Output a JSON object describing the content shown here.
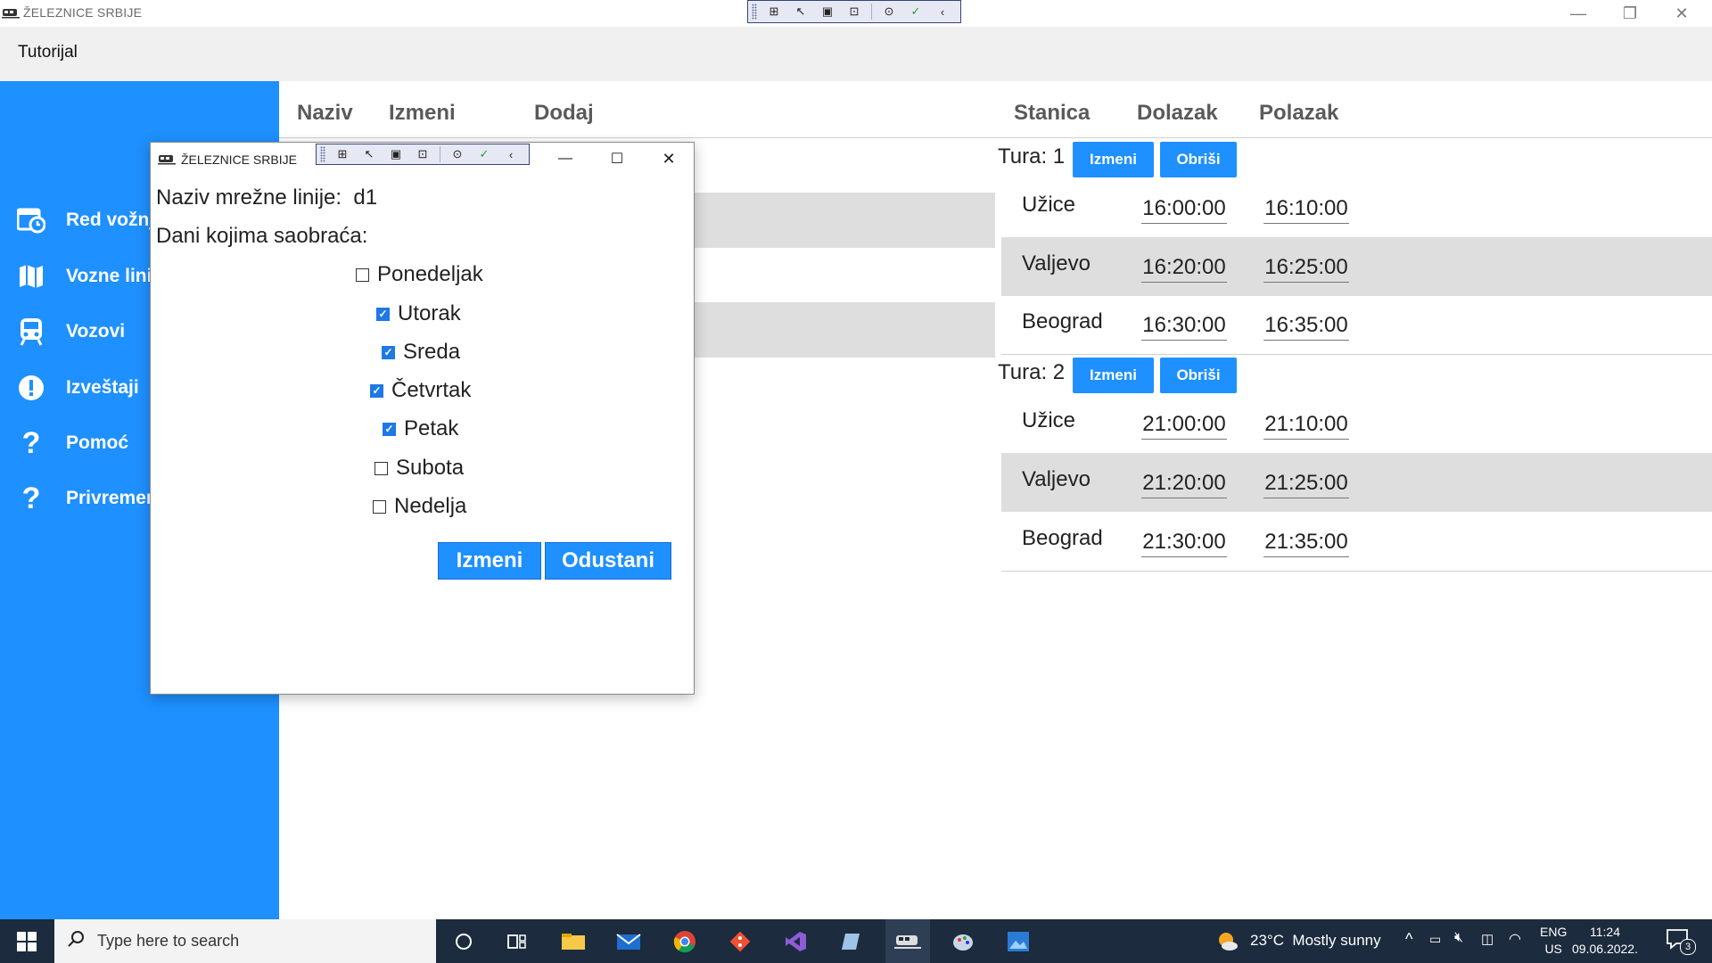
{
  "window": {
    "title": "ŽELEZNICE SRBIJE",
    "controls": [
      "—",
      "❐",
      "✕"
    ]
  },
  "menu": {
    "tutorial": "Tutorijal"
  },
  "sidebar": {
    "items": [
      {
        "label": "Red vožnje",
        "icon": "schedule-icon"
      },
      {
        "label": "Vozne linije",
        "icon": "map-icon"
      },
      {
        "label": "Vozovi",
        "icon": "train-icon"
      },
      {
        "label": "Izveštaji",
        "icon": "alert-icon"
      },
      {
        "label": "Pomoć",
        "icon": "help-icon"
      },
      {
        "label": "Privremeno",
        "icon": "help-icon"
      }
    ]
  },
  "lines_table": {
    "headers": [
      "Naziv",
      "Izmeni",
      "Dodaj"
    ]
  },
  "schedule": {
    "headers": [
      "Stanica",
      "Dolazak",
      "Polazak"
    ],
    "tura_label": "Tura:",
    "edit_label": "Izmeni",
    "delete_label": "Obriši",
    "tours": [
      {
        "number": "1",
        "stops": [
          {
            "station": "Užice",
            "arrival": "16:00:00",
            "departure": "16:10:00"
          },
          {
            "station": "Valjevo",
            "arrival": "16:20:00",
            "departure": "16:25:00"
          },
          {
            "station": "Beograd",
            "arrival": "16:30:00",
            "departure": "16:35:00"
          }
        ]
      },
      {
        "number": "2",
        "stops": [
          {
            "station": "Užice",
            "arrival": "21:00:00",
            "departure": "21:10:00"
          },
          {
            "station": "Valjevo",
            "arrival": "21:20:00",
            "departure": "21:25:00"
          },
          {
            "station": "Beograd",
            "arrival": "21:30:00",
            "departure": "21:35:00"
          }
        ]
      }
    ]
  },
  "dialog": {
    "title": "ŽELEZNICE SRBIJE",
    "line_name_label": "Naziv mrežne linije:",
    "line_name_value": "d1",
    "days_label": "Dani kojima saobraća:",
    "days": [
      {
        "label": "Ponedeljak",
        "checked": false
      },
      {
        "label": "Utorak",
        "checked": true
      },
      {
        "label": "Sreda",
        "checked": true
      },
      {
        "label": "Četvrtak",
        "checked": true
      },
      {
        "label": "Petak",
        "checked": true
      },
      {
        "label": "Subota",
        "checked": false
      },
      {
        "label": "Nedelja",
        "checked": false
      }
    ],
    "confirm_label": "Izmeni",
    "cancel_label": "Odustani"
  },
  "taskbar": {
    "search_placeholder": "Type here to search",
    "weather": "23°C  Mostly sunny",
    "lang_top": "ENG",
    "lang_bottom": "US",
    "time": "11:24",
    "date": "09.06.2022.",
    "notifications": "3"
  },
  "colors": {
    "accent": "#1e90ff",
    "taskbar": "#1c2b3d",
    "row_alt": "#dedede"
  }
}
